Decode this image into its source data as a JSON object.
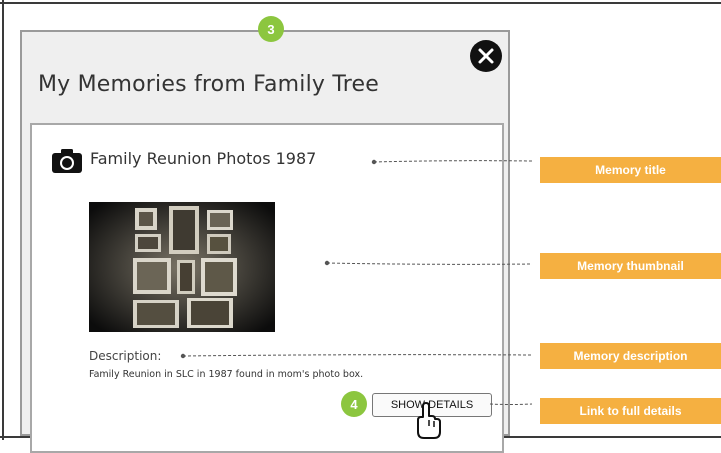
{
  "dialog": {
    "title": "My Memories from Family Tree",
    "close_icon": "close-icon"
  },
  "memory": {
    "icon": "camera-icon",
    "title": "Family Reunion Photos 1987",
    "thumbnail": "family-photos-thumbnail",
    "description_label": "Description:",
    "description_text": "Family Reunion in SLC in 1987 found in mom's  photo box.",
    "details_button_label": "SHOW DETAILS"
  },
  "steps": {
    "top": "3",
    "details": "4"
  },
  "callouts": {
    "title": "Memory title",
    "thumbnail": "Memory thumbnail",
    "description": "Memory description",
    "details_link": "Link to full details"
  },
  "colors": {
    "step_badge": "#8cc63f",
    "callout": "#f5b041",
    "dialog_bg": "#efefef",
    "close_button": "#111111"
  }
}
